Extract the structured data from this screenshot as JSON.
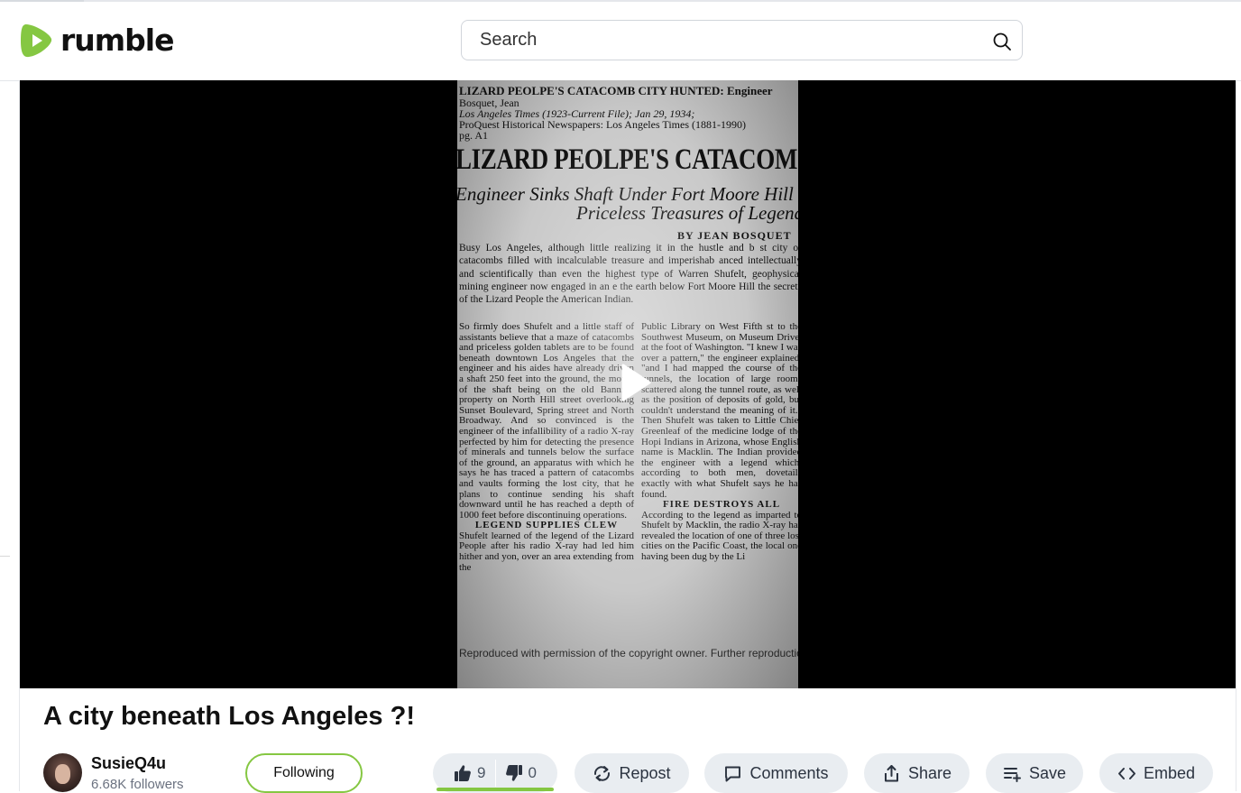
{
  "brand": {
    "name": "rumble",
    "accent_color": "#85c742"
  },
  "search": {
    "placeholder": "Search",
    "icon": "search-icon"
  },
  "video": {
    "title": "A city beneath Los Angeles ?!",
    "play_icon": "play-icon",
    "frame": {
      "meta_line_1": "LIZARD PEOLPE'S CATACOMB CITY HUNTED: Engineer",
      "meta_line_2": "Bosquet, Jean",
      "meta_line_3": "Los Angeles Times (1923-Current File); Jan 29, 1934;",
      "meta_line_4": "ProQuest Historical Newspapers: Los Angeles Times (1881-1990)",
      "meta_line_5": "pg. A1",
      "headline": "LIZARD PEOLPE'S CATACOM",
      "subhead_1": "Engineer Sinks Shaft Under Fort Moore Hill to",
      "subhead_2": "Priceless Treasures of Legenda",
      "byline": "BY JEAN BOSQUET",
      "intro": "Busy Los Angeles, although little realizing it in the hustle and b st city of catacombs filled with incalculable treasure and imperishab anced intellectually and scientifically than even the highest type of Warren Shufelt, geophysical mining engineer now engaged in an e the earth below Fort Moore Hill the secrets of the Lizard People the American Indian.",
      "left_column": "So firmly does Shufelt and a little staff of assistants believe that a maze of catacombs and priceless golden tablets are to be found beneath downtown Los Angeles that the engineer and his aides have already driven a shaft 250 feet into the ground, the mouth of the shaft being on the old Banning property on North Hill street overlooking Sunset Boulevard, Spring street and North Broadway. And so convinced is the engineer of the infallibility of a radio X-ray perfected by him for detecting the presence of minerals and tunnels below the surface of the ground, an apparatus with which he says he has traced a pattern of catacombs and vaults forming the lost city, that he plans to continue sending his shaft downward until he has reached a depth of 1000 feet before discontinuing operations.",
      "left_heading": "LEGEND SUPPLIES CLEW",
      "left_column_2": "Shufelt learned of the legend of the Lizard People after his radio X-ray had led him hither and yon, over an area extending from the",
      "right_column": "Public Library on West Fifth st to the Southwest Museum, on Museum Drive, at the foot of Washington. \"I knew I was over a pattern,\" the engineer explained, \"and I had mapped the course of the tunnels, the location of large rooms scattered along the tunnel route, as well as the position of deposits of gold, but couldn't understand the meaning of it.\" Then Shufelt was taken to Little Chief Greenleaf of the medicine lodge of the Hopi Indians in Arizona, whose English name is Macklin. The Indian provided the engineer with a legend which, according to both men, dovetails exactly with what Shufelt says he has found.",
      "right_heading": "FIRE DESTROYS ALL",
      "right_column_2": "According to the legend as imparted to Shufelt by Macklin, the radio X-ray has revealed the location of one of three lost cities on the Pacific Coast, the local one having been dug by the Li",
      "copyright": "Reproduced with permission of the copyright owner. Further reproduction"
    }
  },
  "channel": {
    "name": "SusieQ4u",
    "followers": "6.68K followers",
    "follow_label": "Following"
  },
  "actions": {
    "likes": "9",
    "dislikes": "0",
    "like_share": 1.0,
    "repost": "Repost",
    "comments": "Comments",
    "share": "Share",
    "save": "Save",
    "embed": "Embed"
  }
}
